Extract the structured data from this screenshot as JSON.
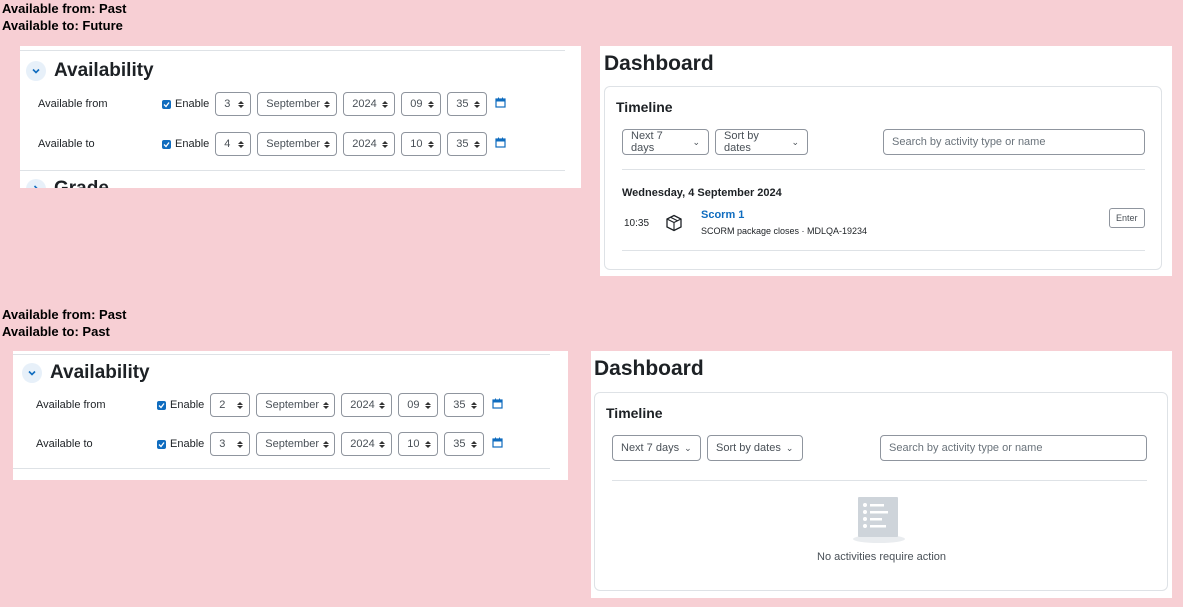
{
  "scenario1": {
    "caption_from": "Available from: Past",
    "caption_to": "Available to: Future",
    "section_title": "Availability",
    "next_section": "Grade",
    "from": {
      "label": "Available from",
      "enable": "Enable",
      "day": "3",
      "month": "September",
      "year": "2024",
      "hour": "09",
      "minute": "35"
    },
    "to": {
      "label": "Available to",
      "enable": "Enable",
      "day": "4",
      "month": "September",
      "year": "2024",
      "hour": "10",
      "minute": "35"
    },
    "dashboard": {
      "title": "Dashboard",
      "timeline": "Timeline",
      "filter": "Next 7 days",
      "sort": "Sort by dates",
      "search_placeholder": "Search by activity type or name",
      "date_header": "Wednesday, 4 September 2024",
      "event": {
        "time": "10:35",
        "name": "Scorm 1",
        "subtitle": "SCORM package closes · MDLQA-19234",
        "action": "Enter"
      }
    }
  },
  "scenario2": {
    "caption_from": "Available from: Past",
    "caption_to": "Available to: Past",
    "section_title": "Availability",
    "from": {
      "label": "Available from",
      "enable": "Enable",
      "day": "2",
      "month": "September",
      "year": "2024",
      "hour": "09",
      "minute": "35"
    },
    "to": {
      "label": "Available to",
      "enable": "Enable",
      "day": "3",
      "month": "September",
      "year": "2024",
      "hour": "10",
      "minute": "35"
    },
    "dashboard": {
      "title": "Dashboard",
      "timeline": "Timeline",
      "filter": "Next 7 days",
      "sort": "Sort by dates",
      "search_placeholder": "Search by activity type or name",
      "empty_message": "No activities require action"
    }
  },
  "colors": {
    "background": "#f7cfd4",
    "link": "#0f6cbf",
    "checkbox": "#0f6cbf"
  }
}
